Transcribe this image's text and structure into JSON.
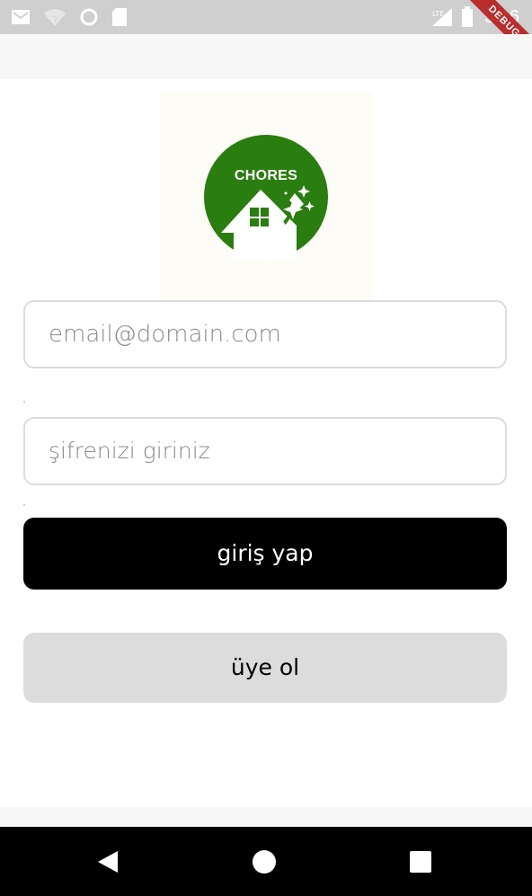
{
  "status_bar": {
    "time": "3:16",
    "icons": [
      "gmail-icon",
      "wifi-icon",
      "circle-icon",
      "sd-card-icon",
      "signal-icon",
      "battery-icon"
    ]
  },
  "debug_banner": {
    "label": "DEBUG"
  },
  "logo": {
    "text": "CHORES",
    "color": "#2a7d0f"
  },
  "form": {
    "email_placeholder": "email@domain.com",
    "password_placeholder": "şifrenizi giriniz"
  },
  "buttons": {
    "login_label": "giriş yap",
    "register_label": "üye ol"
  },
  "nav_bar": {
    "icons": [
      "back-icon",
      "home-icon",
      "recents-icon"
    ]
  }
}
